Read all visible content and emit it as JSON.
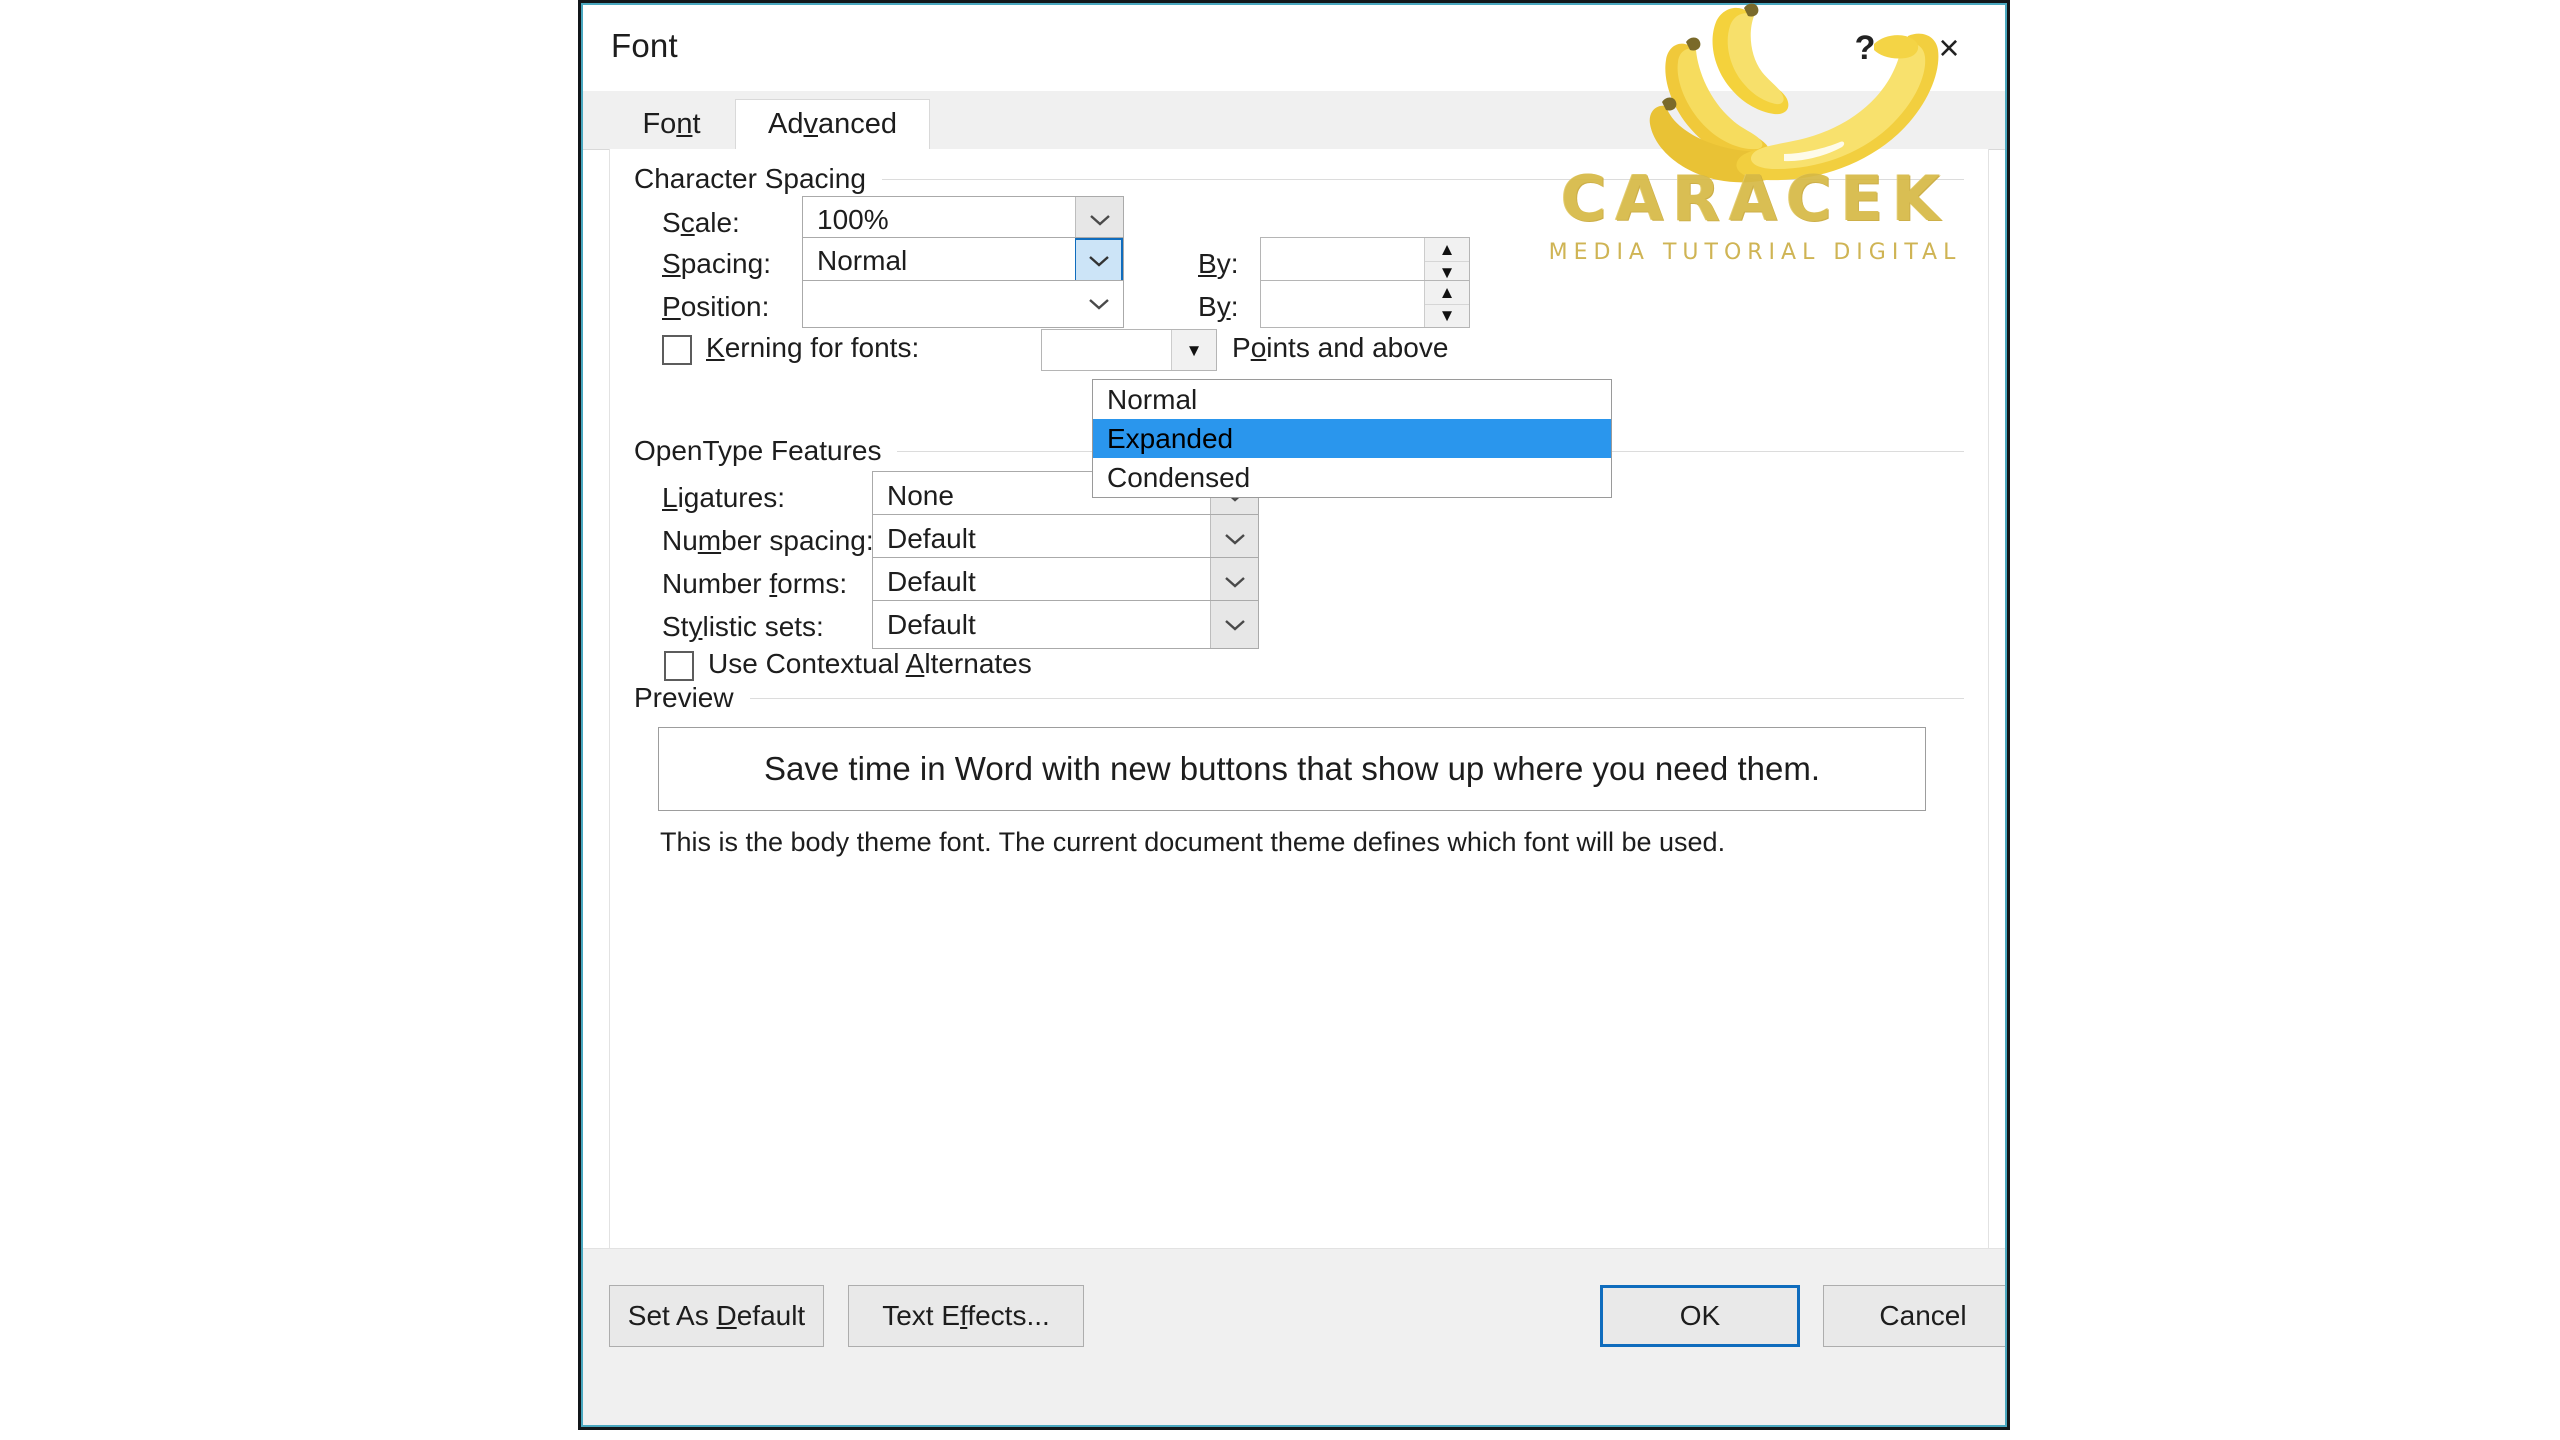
{
  "window": {
    "title": "Font",
    "help_label": "?",
    "close_label": "×"
  },
  "tabs": [
    {
      "label": "Font",
      "accel": "n",
      "active": false
    },
    {
      "label": "Advanced",
      "accel": "v",
      "active": true
    }
  ],
  "character_spacing": {
    "group_label": "Character Spacing",
    "scale": {
      "label": "Scale:",
      "value": "100%"
    },
    "spacing": {
      "label": "Spacing:",
      "value": "Normal",
      "by_label": "By:",
      "by_value": "",
      "open": true,
      "options": [
        "Normal",
        "Expanded",
        "Condensed"
      ],
      "selected_option": "Expanded"
    },
    "position": {
      "label": "Position:",
      "value": "",
      "by_label": "By:",
      "by_value": ""
    },
    "kerning": {
      "label": "Kerning for fonts:",
      "checked": false,
      "value": "",
      "suffix_label": "Points and above"
    }
  },
  "opentype": {
    "group_label": "OpenType Features",
    "rows": [
      {
        "label": "Ligatures:",
        "value": "None"
      },
      {
        "label": "Number spacing:",
        "value": "Default"
      },
      {
        "label": "Number forms:",
        "value": "Default"
      },
      {
        "label": "Stylistic sets:",
        "value": "Default"
      }
    ],
    "contextual_alternates": {
      "label": "Use Contextual Alternates",
      "checked": false
    }
  },
  "preview": {
    "group_label": "Preview",
    "sample_text": "Save time in Word with new buttons that show up where you need them.",
    "description": "This is the body theme font. The current document theme defines which font will be used."
  },
  "footer": {
    "set_as_default": "Set As Default",
    "text_effects": "Text Effects...",
    "ok": "OK",
    "cancel": "Cancel"
  },
  "watermark": {
    "brand": "CARACEK",
    "tagline": "MEDIA TUTORIAL DIGITAL"
  },
  "colors": {
    "highlight_blue": "#2a96ed",
    "focus_blue": "#0f6cbd",
    "dialog_border": "#13171a",
    "dialog_accent": "#4aa8c0",
    "panel_bg": "#f0f0f0",
    "watermark_gold": "#d6b945"
  }
}
